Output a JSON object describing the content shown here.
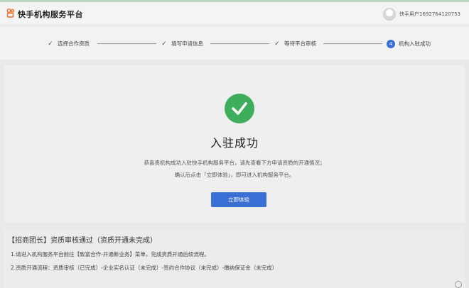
{
  "header": {
    "app_title": "快手机构服务平台",
    "username": "快手用户1692764120753",
    "logo_icon": "kuaishou-logo-icon"
  },
  "steps": [
    {
      "label": "选择合作资质",
      "status": "done"
    },
    {
      "label": "填写申请信息",
      "status": "done"
    },
    {
      "label": "等待平台审核",
      "status": "done"
    },
    {
      "label": "机构入驻成功",
      "status": "current",
      "number": "4"
    }
  ],
  "result": {
    "icon": "check-circle-icon",
    "accent_color": "#3fae5c",
    "title": "入驻成功",
    "desc_line1": "恭喜贵机构成功入驻快手机构服务平台，请先查看下方申请资质的开通情况；",
    "desc_line2": "确认后点击「立即体验」，即可进入机构服务平台。",
    "button_label": "立即体验",
    "button_color": "#3a6fd6"
  },
  "notice": {
    "title": "【招商团长】资质审核通过（资质开通未完成）",
    "line1": "1.请进入机构服务平台前往【致富合作-开通新业务】菜单，完成资质开通后续流程。",
    "line2": "2.资质开通流程：资质审核（已完成）-企业实名认证（未完成）-签约合作协议（未完成）-缴纳保证金（未完成）"
  }
}
